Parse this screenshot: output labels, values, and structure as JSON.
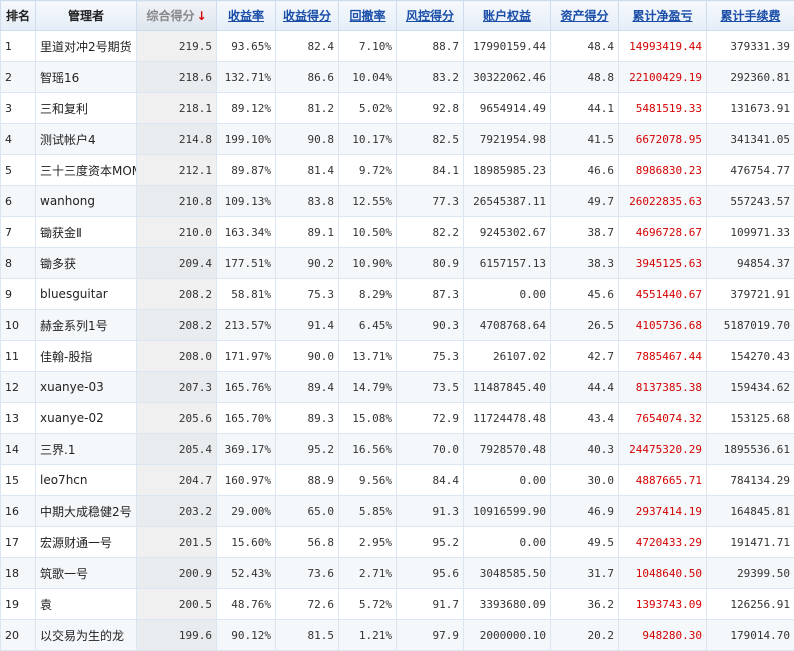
{
  "columns": [
    {
      "label": "排名"
    },
    {
      "label": "管理者"
    },
    {
      "label": "综合得分"
    },
    {
      "label": "收益率"
    },
    {
      "label": "收益得分"
    },
    {
      "label": "回撤率"
    },
    {
      "label": "风控得分"
    },
    {
      "label": "账户权益"
    },
    {
      "label": "资产得分"
    },
    {
      "label": "累计净盈亏"
    },
    {
      "label": "累计手续费"
    }
  ],
  "sort_indicator": "↓",
  "rows": [
    [
      "1",
      "里道对冲2号期货",
      "219.5",
      "93.65%",
      "82.4",
      "7.10%",
      "88.7",
      "17990159.44",
      "48.4",
      "14993419.44",
      "379331.39"
    ],
    [
      "2",
      "智瑶16",
      "218.6",
      "132.71%",
      "86.6",
      "10.04%",
      "83.2",
      "30322062.46",
      "48.8",
      "22100429.19",
      "292360.81"
    ],
    [
      "3",
      "三和复利",
      "218.1",
      "89.12%",
      "81.2",
      "5.02%",
      "92.8",
      "9654914.49",
      "44.1",
      "5481519.33",
      "131673.91"
    ],
    [
      "4",
      "测试帐户4",
      "214.8",
      "199.10%",
      "90.8",
      "10.17%",
      "82.5",
      "7921954.98",
      "41.5",
      "6672078.95",
      "341341.05"
    ],
    [
      "5",
      "三十三度资本MOM",
      "212.1",
      "89.87%",
      "81.4",
      "9.72%",
      "84.1",
      "18985985.23",
      "46.6",
      "8986830.23",
      "476754.77"
    ],
    [
      "6",
      "wanhong",
      "210.8",
      "109.13%",
      "83.8",
      "12.55%",
      "77.3",
      "26545387.11",
      "49.7",
      "26022835.63",
      "557243.57"
    ],
    [
      "7",
      "锄获金Ⅱ",
      "210.0",
      "163.34%",
      "89.1",
      "10.50%",
      "82.2",
      "9245302.67",
      "38.7",
      "4696728.67",
      "109971.33"
    ],
    [
      "8",
      "锄多获",
      "209.4",
      "177.51%",
      "90.2",
      "10.90%",
      "80.9",
      "6157157.13",
      "38.3",
      "3945125.63",
      "94854.37"
    ],
    [
      "9",
      "bluesguitar",
      "208.2",
      "58.81%",
      "75.3",
      "8.29%",
      "87.3",
      "0.00",
      "45.6",
      "4551440.67",
      "379721.91"
    ],
    [
      "10",
      "赫金系列1号",
      "208.2",
      "213.57%",
      "91.4",
      "6.45%",
      "90.3",
      "4708768.64",
      "26.5",
      "4105736.68",
      "5187019.70"
    ],
    [
      "11",
      "佳翰-股指",
      "208.0",
      "171.97%",
      "90.0",
      "13.71%",
      "75.3",
      "26107.02",
      "42.7",
      "7885467.44",
      "154270.43"
    ],
    [
      "12",
      "xuanye-03",
      "207.3",
      "165.76%",
      "89.4",
      "14.79%",
      "73.5",
      "11487845.40",
      "44.4",
      "8137385.38",
      "159434.62"
    ],
    [
      "13",
      "xuanye-02",
      "205.6",
      "165.70%",
      "89.3",
      "15.08%",
      "72.9",
      "11724478.48",
      "43.4",
      "7654074.32",
      "153125.68"
    ],
    [
      "14",
      "三界.1",
      "205.4",
      "369.17%",
      "95.2",
      "16.56%",
      "70.0",
      "7928570.48",
      "40.3",
      "24475320.29",
      "1895536.61"
    ],
    [
      "15",
      "leo7hcn",
      "204.7",
      "160.97%",
      "88.9",
      "9.56%",
      "84.4",
      "0.00",
      "30.0",
      "4887665.71",
      "784134.29"
    ],
    [
      "16",
      "中期大成稳健2号",
      "203.2",
      "29.00%",
      "65.0",
      "5.85%",
      "91.3",
      "10916599.90",
      "46.9",
      "2937414.19",
      "164845.81"
    ],
    [
      "17",
      "宏源财通一号",
      "201.5",
      "15.60%",
      "56.8",
      "2.95%",
      "95.2",
      "0.00",
      "49.5",
      "4720433.29",
      "191471.71"
    ],
    [
      "18",
      "筑歌一号",
      "200.9",
      "52.43%",
      "73.6",
      "2.71%",
      "95.6",
      "3048585.50",
      "31.7",
      "1048640.50",
      "29399.50"
    ],
    [
      "19",
      "袁",
      "200.5",
      "48.76%",
      "72.6",
      "5.72%",
      "91.7",
      "3393680.09",
      "36.2",
      "1393743.09",
      "126256.91"
    ],
    [
      "20",
      "以交易为生的龙",
      "199.6",
      "90.12%",
      "81.5",
      "1.21%",
      "97.9",
      "2000000.10",
      "20.2",
      "948280.30",
      "179014.70"
    ]
  ]
}
